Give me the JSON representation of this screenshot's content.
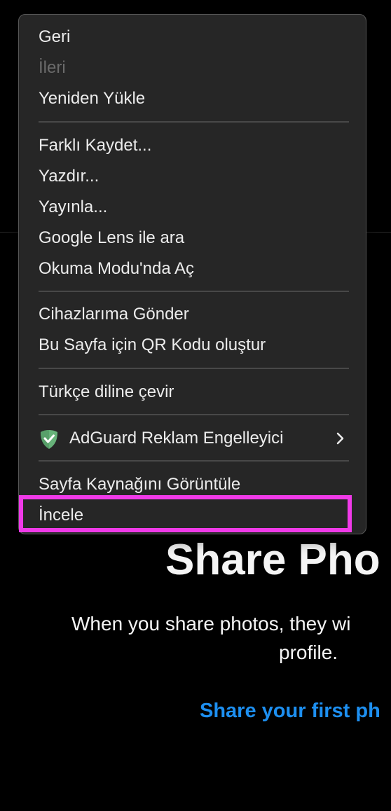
{
  "background_page": {
    "title": "Share Pho",
    "description_line1": "When you share photos, they wi",
    "description_line2": "profile.",
    "link_text": "Share your first ph"
  },
  "context_menu": {
    "items": [
      {
        "label": "Geri",
        "enabled": true
      },
      {
        "label": "İleri",
        "enabled": false
      },
      {
        "label": "Yeniden Yükle",
        "enabled": true
      },
      {
        "label": "Farklı Kaydet...",
        "enabled": true
      },
      {
        "label": "Yazdır...",
        "enabled": true
      },
      {
        "label": "Yayınla...",
        "enabled": true
      },
      {
        "label": "Google Lens ile ara",
        "enabled": true
      },
      {
        "label": "Okuma Modu'nda Aç",
        "enabled": true
      },
      {
        "label": "Cihazlarıma Gönder",
        "enabled": true
      },
      {
        "label": "Bu Sayfa için QR Kodu oluştur",
        "enabled": true
      },
      {
        "label": "Türkçe diline çevir",
        "enabled": true
      },
      {
        "label": "AdGuard Reklam Engelleyici",
        "enabled": true,
        "icon": "adguard-shield-icon",
        "has_submenu": true
      },
      {
        "label": "Sayfa Kaynağını Görüntüle",
        "enabled": true
      },
      {
        "label": "İncele",
        "enabled": true,
        "highlighted": true
      }
    ]
  },
  "colors": {
    "page_background": "#000000",
    "menu_background": "#262626",
    "menu_text": "#ececec",
    "disabled_text": "#6b6b6b",
    "link": "#1d8ff0",
    "highlight": "#f03ae8",
    "adguard_green": "#67b279"
  }
}
